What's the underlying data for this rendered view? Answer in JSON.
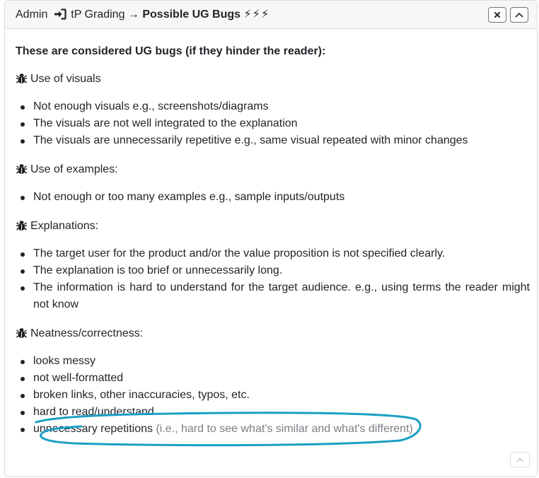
{
  "header": {
    "breadcrumb_start": "Admin",
    "breadcrumb_tp": "tP Grading →",
    "title": "Possible UG Bugs",
    "bolts": "⚡⚡⚡"
  },
  "content": {
    "heading": "These are considered UG bugs (if they hinder the reader):",
    "categories": [
      {
        "label": "Use of visuals",
        "items": [
          "Not enough visuals e.g., screenshots/diagrams",
          "The visuals are not well integrated to the explanation",
          "The visuals are unnecessarily repetitive e.g., same visual repeated with minor changes"
        ]
      },
      {
        "label": "Use of examples:",
        "items": [
          "Not enough or too many examples e.g., sample inputs/outputs"
        ]
      },
      {
        "label": "Explanations:",
        "items": [
          "The target user for the product and/or the value proposition is not specified clearly.",
          "The explanation is too brief or unnecessarily long.",
          "The information is hard to understand for the target audience. e.g., using terms the reader might",
          "not know"
        ]
      },
      {
        "label": "Neatness/correctness:",
        "items": [
          "looks messy",
          "not well-formatted",
          "broken links, other inaccuracies, typos, etc.",
          "hard to read/understand"
        ],
        "last_item_main": "unnecessary repetitions",
        "last_item_note": "(i.e., hard to see what's similar and what's different)"
      }
    ]
  },
  "colors": {
    "annotation": "#1a9fc4",
    "header_bg": "#f7f7f7"
  },
  "icons": {
    "login": "sign-in-icon",
    "bug": "bug-icon",
    "close": "close-icon",
    "collapse": "chevron-up-icon"
  }
}
